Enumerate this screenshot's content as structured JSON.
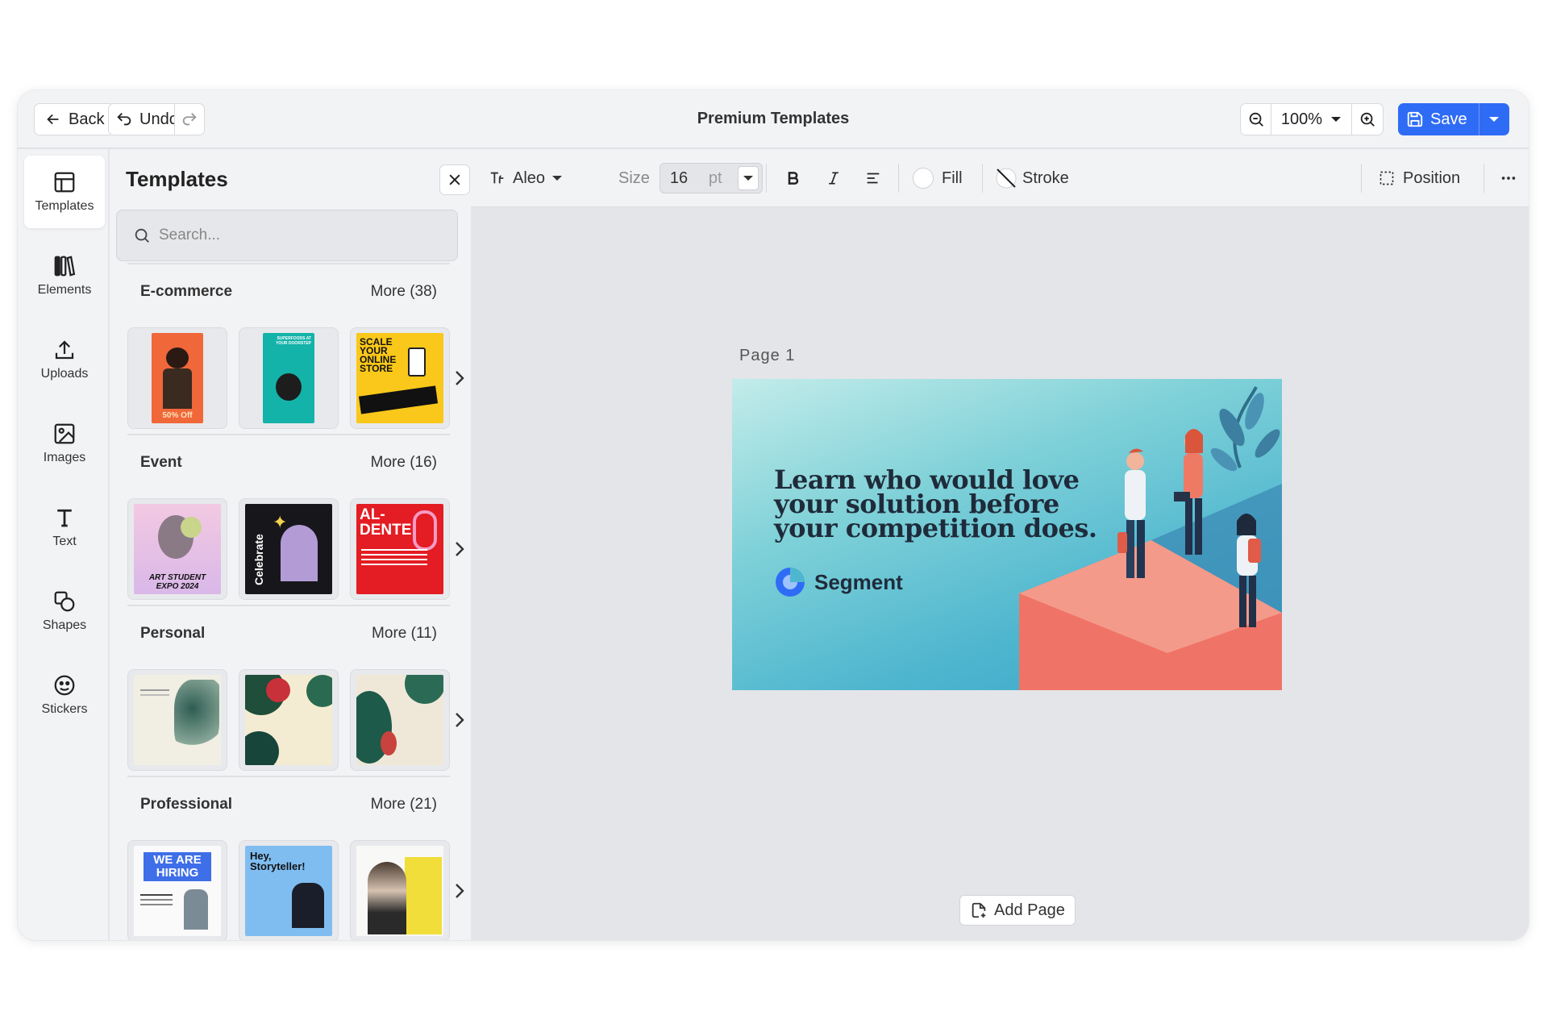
{
  "topbar": {
    "back_label": "Back",
    "undo_label": "Undo",
    "title": "Premium Templates",
    "zoom": "100%",
    "save_label": "Save"
  },
  "rail": {
    "items": [
      {
        "label": "Templates",
        "icon": "layout-icon"
      },
      {
        "label": "Elements",
        "icon": "books-icon"
      },
      {
        "label": "Uploads",
        "icon": "upload-icon"
      },
      {
        "label": "Images",
        "icon": "image-icon"
      },
      {
        "label": "Text",
        "icon": "text-icon"
      },
      {
        "label": "Shapes",
        "icon": "shapes-icon"
      },
      {
        "label": "Stickers",
        "icon": "sticker-icon"
      }
    ]
  },
  "panel": {
    "title": "Templates",
    "search_placeholder": "Search...",
    "categories": [
      {
        "name": "E-commerce",
        "more": "More (38)",
        "thumbs": [
          {
            "text": "50% Off"
          },
          {
            "text": "SUPERFOODS AT YOUR DOORSTEP"
          },
          {
            "text": "SCALE YOUR ONLINE STORE"
          }
        ]
      },
      {
        "name": "Event",
        "more": "More (16)",
        "thumbs": [
          {
            "text": "ART STUDENT EXPO 2024"
          },
          {
            "text": "Celebrate"
          },
          {
            "text": "AL-DENTE"
          }
        ]
      },
      {
        "name": "Personal",
        "more": "More (11)",
        "thumbs": [
          {
            "text": ""
          },
          {
            "text": ""
          },
          {
            "text": ""
          }
        ]
      },
      {
        "name": "Professional",
        "more": "More (21)",
        "thumbs": [
          {
            "text": "WE ARE HIRING"
          },
          {
            "text": "Hey, Storyteller!"
          },
          {
            "text": ""
          }
        ]
      }
    ]
  },
  "toolbar": {
    "font": "Aleo",
    "size_label": "Size",
    "size_value": "16",
    "size_unit": "pt",
    "fill_label": "Fill",
    "stroke_label": "Stroke",
    "position_label": "Position"
  },
  "canvas": {
    "page_label": "Page 1",
    "headline": "Learn who would love your solution before your competition does.",
    "brand": "Segment",
    "add_page_label": "Add Page"
  },
  "colors": {
    "accent": "#2f6cf6"
  }
}
